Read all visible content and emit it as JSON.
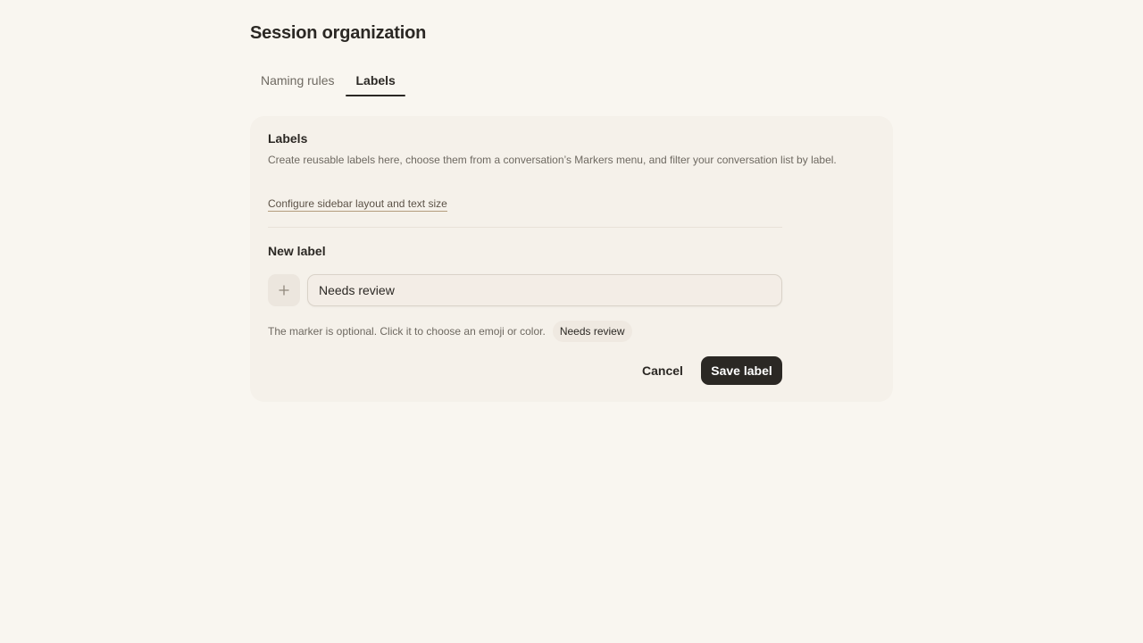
{
  "page": {
    "title": "Session organization"
  },
  "tabs": [
    {
      "label": "Naming rules",
      "active": false
    },
    {
      "label": "Labels",
      "active": true
    }
  ],
  "labels_section": {
    "title": "Labels",
    "description": "Create reusable labels here, choose them from a conversation’s Markers menu, and filter your conversation list by label.",
    "config_link": "Configure sidebar layout and text size"
  },
  "new_label": {
    "title": "New label",
    "marker_icon": "plus-icon",
    "input_value": "Needs review",
    "helper_text": "The marker is optional. Click it to choose an emoji or color.",
    "preview_label": "Needs review"
  },
  "actions": {
    "cancel_label": "Cancel",
    "save_label": "Save label"
  },
  "colors": {
    "background": "#f9f6f0",
    "card": "#f5f1ea",
    "primary_button": "#2b2824",
    "link_underline": "#b39c7d"
  }
}
